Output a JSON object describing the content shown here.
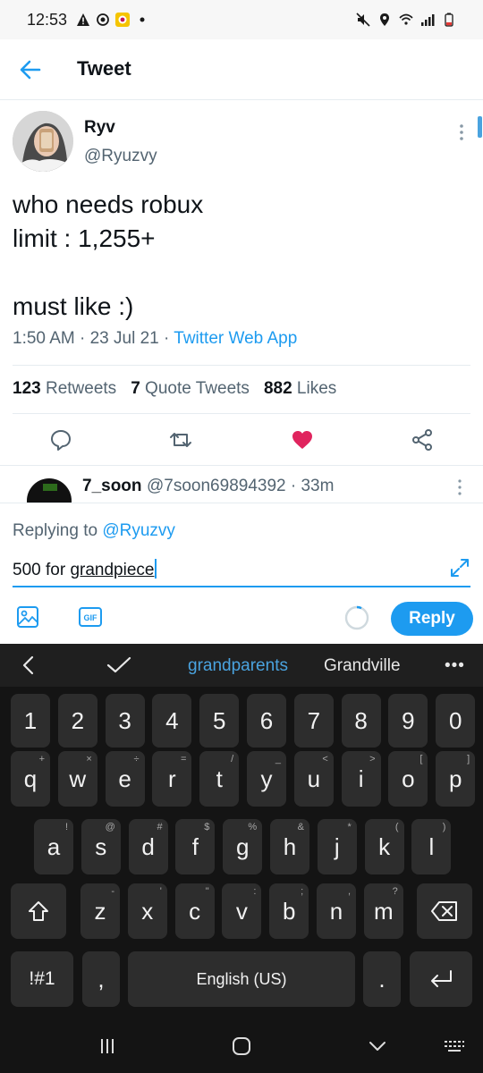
{
  "status_bar": {
    "time": "12:53",
    "left_icons": [
      "warning-icon",
      "sync-icon",
      "app-icon",
      "dot-icon"
    ],
    "right_icons": [
      "mute-icon",
      "location-icon",
      "wifi-icon",
      "signal-icon",
      "battery-icon"
    ]
  },
  "header": {
    "title": "Tweet"
  },
  "tweet": {
    "author_name": "Ryv",
    "author_handle": "@Ryuzvy",
    "text": "who needs robux\nlimit : 1,255+\n\nmust like :)",
    "time": "1:50 AM",
    "date": "23 Jul 21",
    "source": "Twitter Web App",
    "stats": {
      "retweets_count": "123",
      "retweets_label": "Retweets",
      "quotes_count": "7",
      "quotes_label": "Quote Tweets",
      "likes_count": "882",
      "likes_label": "Likes"
    },
    "liked": true,
    "colors": {
      "accent": "#1d9bf0",
      "like": "#e0245e"
    }
  },
  "reply_preview": {
    "name": "7_soon",
    "handle_time": "@7soon69894392 · 33m"
  },
  "compose": {
    "replying_prefix": "Replying to",
    "replying_mention": "@Ryuzvy",
    "input_prefix": "500 for ",
    "input_word": "grandpiece",
    "reply_button": "Reply",
    "gif_label": "GIF"
  },
  "keyboard": {
    "suggestions": [
      "grandparents",
      "Grandville"
    ],
    "more": "•••",
    "number_row": [
      "1",
      "2",
      "3",
      "4",
      "5",
      "6",
      "7",
      "8",
      "9",
      "0"
    ],
    "row1": [
      {
        "k": "q",
        "h": "+"
      },
      {
        "k": "w",
        "h": "×"
      },
      {
        "k": "e",
        "h": "÷"
      },
      {
        "k": "r",
        "h": "="
      },
      {
        "k": "t",
        "h": "/"
      },
      {
        "k": "y",
        "h": "_"
      },
      {
        "k": "u",
        "h": "<"
      },
      {
        "k": "i",
        "h": ">"
      },
      {
        "k": "o",
        "h": "["
      },
      {
        "k": "p",
        "h": "]"
      }
    ],
    "row2": [
      {
        "k": "a",
        "h": "!"
      },
      {
        "k": "s",
        "h": "@"
      },
      {
        "k": "d",
        "h": "#"
      },
      {
        "k": "f",
        "h": "$"
      },
      {
        "k": "g",
        "h": "%"
      },
      {
        "k": "h",
        "h": "&"
      },
      {
        "k": "j",
        "h": "*"
      },
      {
        "k": "k",
        "h": "("
      },
      {
        "k": "l",
        "h": ")"
      }
    ],
    "row3": [
      {
        "k": "z",
        "h": "-"
      },
      {
        "k": "x",
        "h": "'"
      },
      {
        "k": "c",
        "h": "\""
      },
      {
        "k": "v",
        "h": ":"
      },
      {
        "k": "b",
        "h": ";"
      },
      {
        "k": "n",
        "h": ","
      },
      {
        "k": "m",
        "h": "?"
      }
    ],
    "symbols_key": "!#1",
    "comma_key": ",",
    "space_label": "English (US)",
    "period_key": "."
  }
}
